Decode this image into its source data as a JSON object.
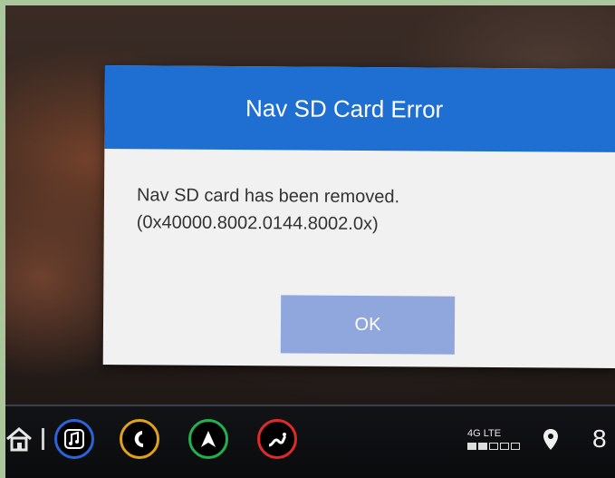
{
  "dialog": {
    "title": "Nav SD Card Error",
    "message_line1": "Nav SD card has been removed.",
    "message_line2": "(0x40000.8002.0144.8002.0x)",
    "ok_label": "OK"
  },
  "bottom_bar": {
    "icons": [
      "home-icon",
      "music-icon",
      "phone-icon",
      "navigation-icon",
      "apps-icon"
    ],
    "network_label": "4G LTE",
    "signal_strength_filled": 2,
    "signal_strength_total": 5,
    "clock_partial": "8"
  },
  "colors": {
    "dialog_header": "#1f6fd2",
    "ok_button": "#8fa7dc",
    "music_ring": "#2a64d8",
    "phone_ring": "#e1a21a",
    "nav_ring": "#22b14c",
    "apps_ring": "#e02a2a"
  }
}
